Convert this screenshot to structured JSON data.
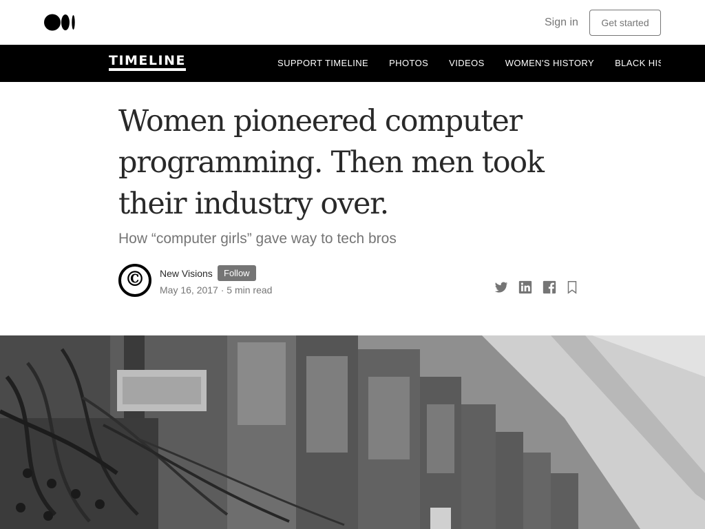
{
  "header": {
    "logo_icon": "medium-logo-icon",
    "signin_label": "Sign in",
    "getstarted_label": "Get started"
  },
  "publication": {
    "name": "TIMELINE",
    "nav": [
      "SUPPORT TIMELINE",
      "PHOTOS",
      "VIDEOS",
      "WOMEN'S HISTORY",
      "BLACK HISTORY"
    ]
  },
  "article": {
    "title": "Women pioneered computer programming. Then men took their industry over.",
    "subtitle": "How “computer girls” gave way to tech bros",
    "author": {
      "avatar_glyph": "©",
      "name": "New Visions",
      "follow_label": "Follow",
      "date": "May 16, 2017",
      "separator": "·",
      "read_time": "5 min read"
    },
    "share_icons": [
      "twitter-icon",
      "linkedin-icon",
      "facebook-icon",
      "bookmark-icon"
    ],
    "hero_image": "black-and-white photo of early computer machinery with cables"
  },
  "colors": {
    "nav_bg": "#000000",
    "text": "#292929",
    "muted": "#757575"
  }
}
